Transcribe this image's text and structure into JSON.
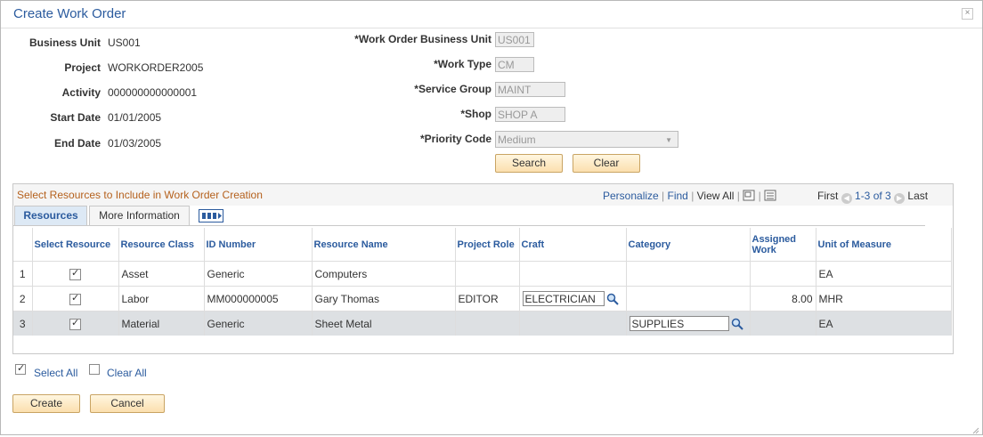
{
  "dialog": {
    "title": "Create Work Order",
    "close": "×"
  },
  "left_fields": [
    {
      "label": "Business Unit",
      "value": "US001"
    },
    {
      "label": "Project",
      "value": "WORKORDER2005"
    },
    {
      "label": "Activity",
      "value": "000000000000001"
    },
    {
      "label": "Start Date",
      "value": "01/01/2005"
    },
    {
      "label": "End Date",
      "value": "01/03/2005"
    }
  ],
  "right_fields": {
    "wo_bu": {
      "label": "*Work Order Business Unit",
      "value": "US001"
    },
    "work_type": {
      "label": "*Work Type",
      "value": "CM"
    },
    "service_group": {
      "label": "*Service Group",
      "value": "MAINT"
    },
    "shop": {
      "label": "*Shop",
      "value": "SHOP A"
    },
    "priority": {
      "label": "*Priority Code",
      "value": "Medium"
    }
  },
  "buttons": {
    "search": "Search",
    "clear": "Clear",
    "create": "Create",
    "cancel": "Cancel"
  },
  "grid": {
    "title": "Select Resources to Include in Work Order Creation",
    "personalize": "Personalize",
    "find": "Find",
    "view_all": "View All",
    "first": "First",
    "range": "1-3 of 3",
    "last": "Last",
    "tabs": [
      "Resources",
      "More Information"
    ],
    "columns": [
      "Select Resource",
      "Resource Class",
      "ID Number",
      "Resource Name",
      "Project Role",
      "Craft",
      "Category",
      "Assigned Work",
      "Unit of Measure"
    ],
    "rows": [
      {
        "num": "1",
        "selected": true,
        "class": "Asset",
        "id": "Generic",
        "name": "Computers",
        "role": "",
        "craft": "",
        "category": "",
        "assigned": "",
        "uom": "EA"
      },
      {
        "num": "2",
        "selected": true,
        "class": "Labor",
        "id": "MM000000005",
        "name": "Gary Thomas",
        "role": "EDITOR",
        "craft": "ELECTRICIAN",
        "category": "",
        "assigned": "8.00",
        "uom": "MHR"
      },
      {
        "num": "3",
        "selected": true,
        "class": "Material",
        "id": "Generic",
        "name": "Sheet Metal",
        "role": "",
        "craft": "",
        "category": "SUPPLIES",
        "assigned": "",
        "uom": "EA"
      }
    ]
  },
  "select_all": "Select All",
  "clear_all": "Clear All"
}
